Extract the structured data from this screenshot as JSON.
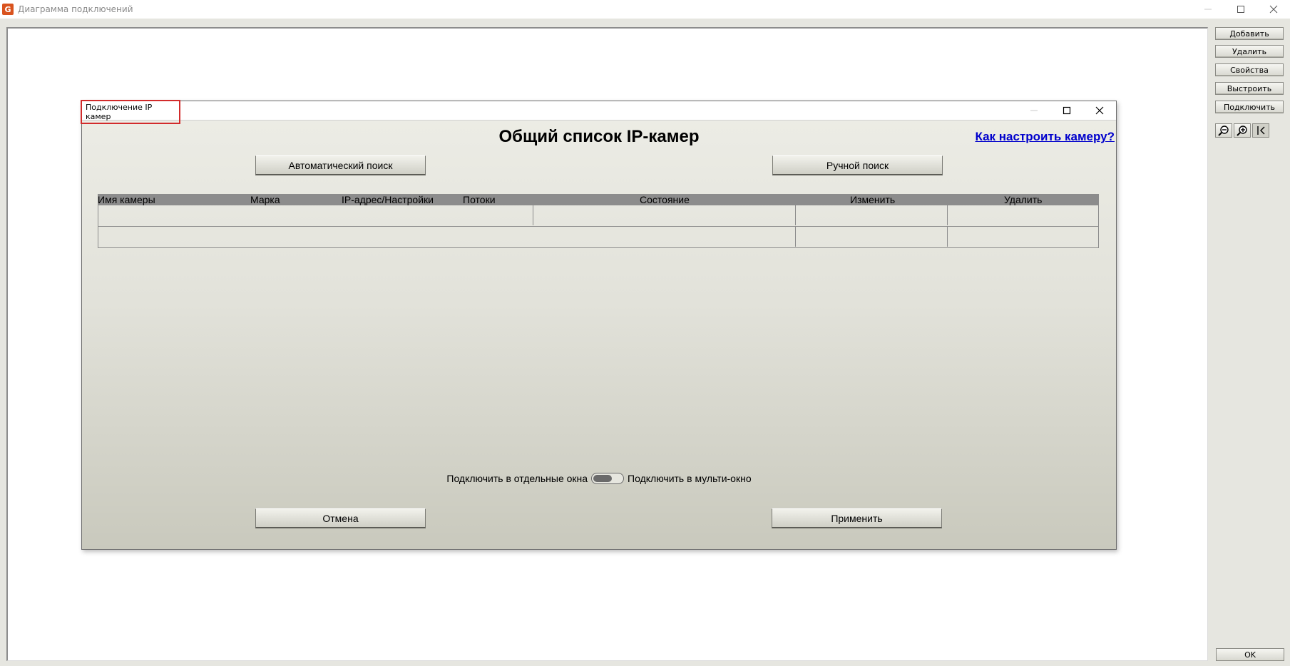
{
  "window": {
    "title": "Диаграмма подключений",
    "icon_letter": "G"
  },
  "side_panel": {
    "buttons": [
      "Добавить",
      "Удалить",
      "Свойства",
      "Выстроить",
      "Подключить"
    ],
    "ok_label": "OK"
  },
  "dialog": {
    "title": "Подключение IP камер",
    "heading": "Общий список IP-камер",
    "help_link": "Как настроить камеру?",
    "auto_search_label": "Автоматический поиск",
    "manual_search_label": "Ручной поиск",
    "table": {
      "columns": [
        "Имя камеры",
        "Марка",
        "IP-адрес/Настройки",
        "Потоки",
        "Состояние",
        "Изменить",
        "Удалить"
      ]
    },
    "toggle": {
      "left_label": "Подключить в отдельные окна",
      "right_label": "Подключить в мульти-окно"
    },
    "cancel_label": "Отмена",
    "apply_label": "Применить"
  },
  "colors": {
    "highlight_border": "#d22b2b",
    "link": "#0000cc",
    "header_gray": "#8c8c8c"
  }
}
